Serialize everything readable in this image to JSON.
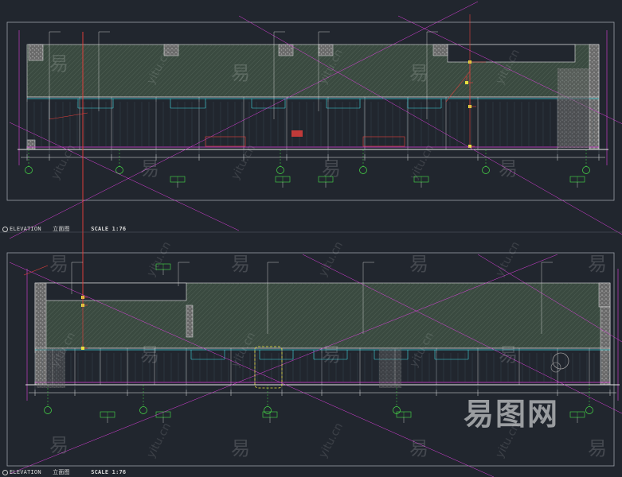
{
  "drawings": [
    {
      "label": "ELEVATION",
      "cn": "立面图",
      "scale": "SCALE 1:76"
    },
    {
      "label": "ELEVATION",
      "cn": "立面图",
      "scale": "SCALE 1:76"
    }
  ],
  "watermark": {
    "char": "易",
    "url": "yitu.cn",
    "logo": "易图网"
  },
  "colors": {
    "background": "#21262e",
    "frame": "#9aa0a8",
    "wall": "#3a4a40",
    "hatch": "#5d6e62",
    "column": "#8c8c8c",
    "red": "#e8403c",
    "magenta": "#e040e0",
    "cyan": "#40d8e0",
    "green": "#48e048",
    "yellow": "#e8e040",
    "white": "#e6e6e6"
  },
  "grid_tags": {
    "top": [
      "1-1",
      "1-2",
      "1-3",
      "1-4",
      "1-5"
    ],
    "bottom": [
      "1-1",
      "1-2",
      "1-3",
      "1-4",
      "1-5"
    ]
  }
}
